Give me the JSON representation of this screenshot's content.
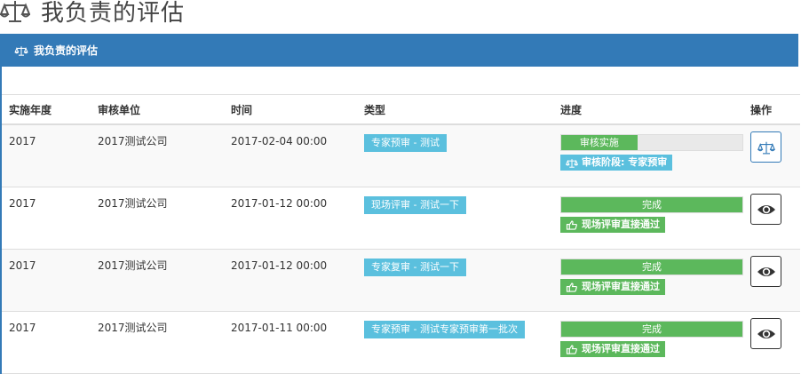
{
  "page": {
    "title": "我负责的评估"
  },
  "panel": {
    "heading": "我负责的评估"
  },
  "table": {
    "headers": [
      "实施年度",
      "审核单位",
      "时间",
      "类型",
      "进度",
      "操作"
    ],
    "rows": [
      {
        "year": "2017",
        "unit": "2017测试公司",
        "time": "2017-02-04 00:00",
        "type": "专家预审 - 测试",
        "progress_label": "审核实施",
        "progress_pct": 42,
        "status": "审核阶段: 专家预审",
        "status_kind": "info",
        "action_icon": "scale-icon"
      },
      {
        "year": "2017",
        "unit": "2017测试公司",
        "time": "2017-01-12 00:00",
        "type": "现场评审 - 测试一下",
        "progress_label": "完成",
        "progress_pct": 100,
        "status": "现场评审直接通过",
        "status_kind": "success",
        "action_icon": "eye-icon"
      },
      {
        "year": "2017",
        "unit": "2017测试公司",
        "time": "2017-01-12 00:00",
        "type": "专家复审 - 测试一下",
        "progress_label": "完成",
        "progress_pct": 100,
        "status": "现场评审直接通过",
        "status_kind": "success",
        "action_icon": "eye-icon"
      },
      {
        "year": "2017",
        "unit": "2017测试公司",
        "time": "2017-01-11 00:00",
        "type": "专家预审 - 测试专家预审第一批次",
        "progress_label": "完成",
        "progress_pct": 100,
        "status": "现场评审直接通过",
        "status_kind": "success",
        "action_icon": "eye-icon"
      }
    ]
  },
  "colors": {
    "primary": "#337ab7",
    "info": "#5bc0de",
    "success": "#5cb85c"
  }
}
